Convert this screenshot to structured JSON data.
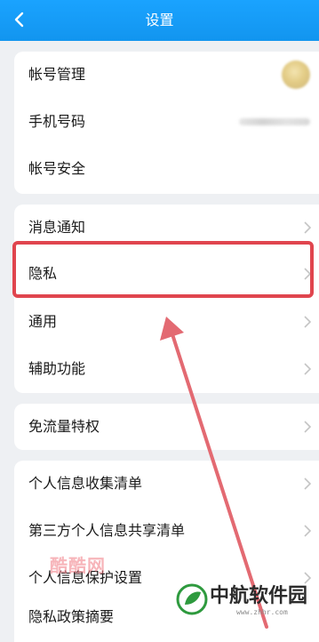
{
  "header": {
    "title": "设置"
  },
  "sections": [
    {
      "items": [
        {
          "label": "帐号管理"
        },
        {
          "label": "手机号码"
        },
        {
          "label": "帐号安全"
        }
      ]
    },
    {
      "items": [
        {
          "label": "消息通知"
        },
        {
          "label": "隐私"
        },
        {
          "label": "通用"
        },
        {
          "label": "辅助功能"
        }
      ]
    },
    {
      "items": [
        {
          "label": "免流量特权"
        }
      ]
    },
    {
      "items": [
        {
          "label": "个人信息收集清单"
        },
        {
          "label": "第三方个人信息共享清单"
        },
        {
          "label": "个人信息保护设置"
        },
        {
          "label": "隐私政策摘要"
        }
      ]
    }
  ],
  "watermarks": {
    "left_text": "酷酷网",
    "logo_text": "中航软件园",
    "logo_domain": "www.zhhr.com"
  },
  "colors": {
    "header": "#1296f0",
    "highlight": "#e0454e",
    "background": "#eef0f3"
  }
}
